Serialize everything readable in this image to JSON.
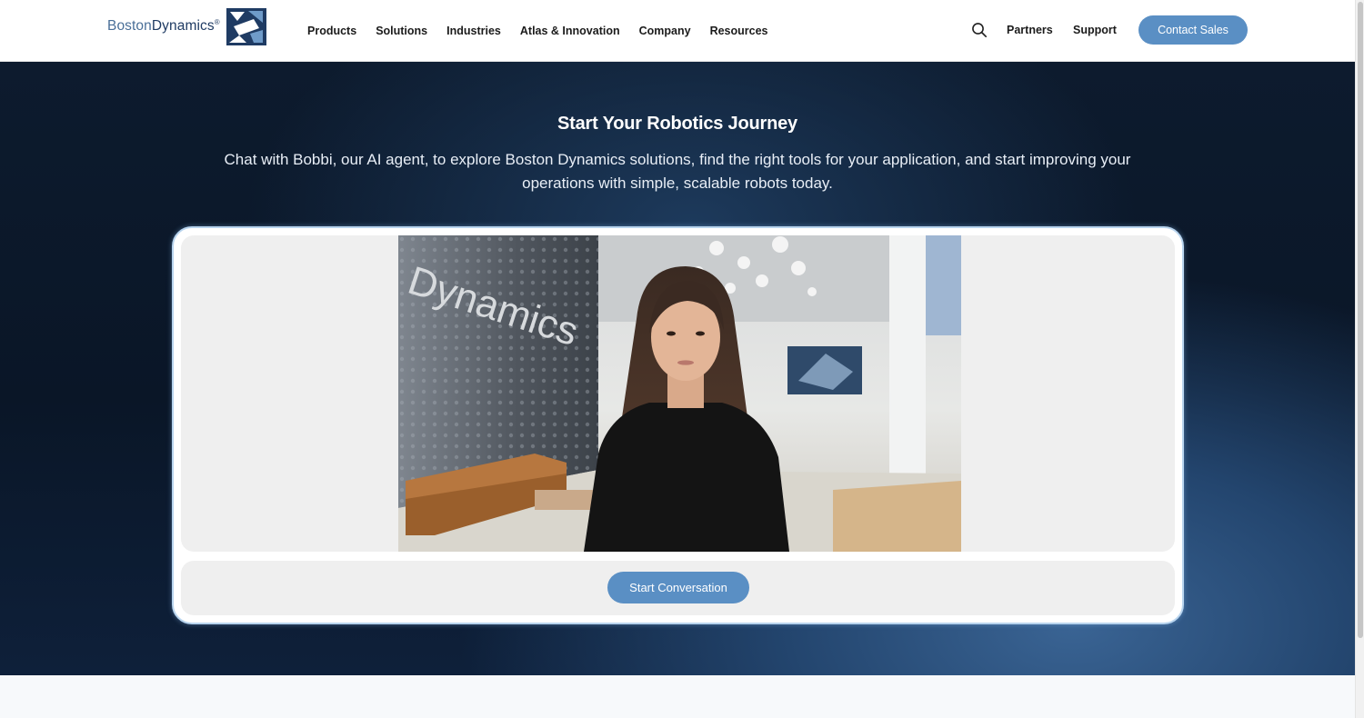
{
  "header": {
    "logo": {
      "word1": "Boston",
      "word2": "Dynamics",
      "mark": "®"
    },
    "nav": [
      {
        "label": "Products"
      },
      {
        "label": "Solutions"
      },
      {
        "label": "Industries"
      },
      {
        "label": "Atlas & Innovation"
      },
      {
        "label": "Company"
      },
      {
        "label": "Resources"
      }
    ],
    "search_icon": "search-icon",
    "partners_label": "Partners",
    "support_label": "Support",
    "contact_label": "Contact Sales"
  },
  "hero": {
    "title": "Start Your Robotics Journey",
    "subtitle": "Chat with Bobbi, our AI agent, to explore Boston Dynamics solutions, find the right tools for your application, and start improving your operations with simple, scalable robots today."
  },
  "agent": {
    "wall_text": "Dynamics",
    "start_label": "Start Conversation"
  },
  "colors": {
    "accent": "#5a8fc4",
    "hero_dark": "#0d1b2e",
    "hero_blue": "#3a6494",
    "card_border": "#b8d4ee"
  }
}
